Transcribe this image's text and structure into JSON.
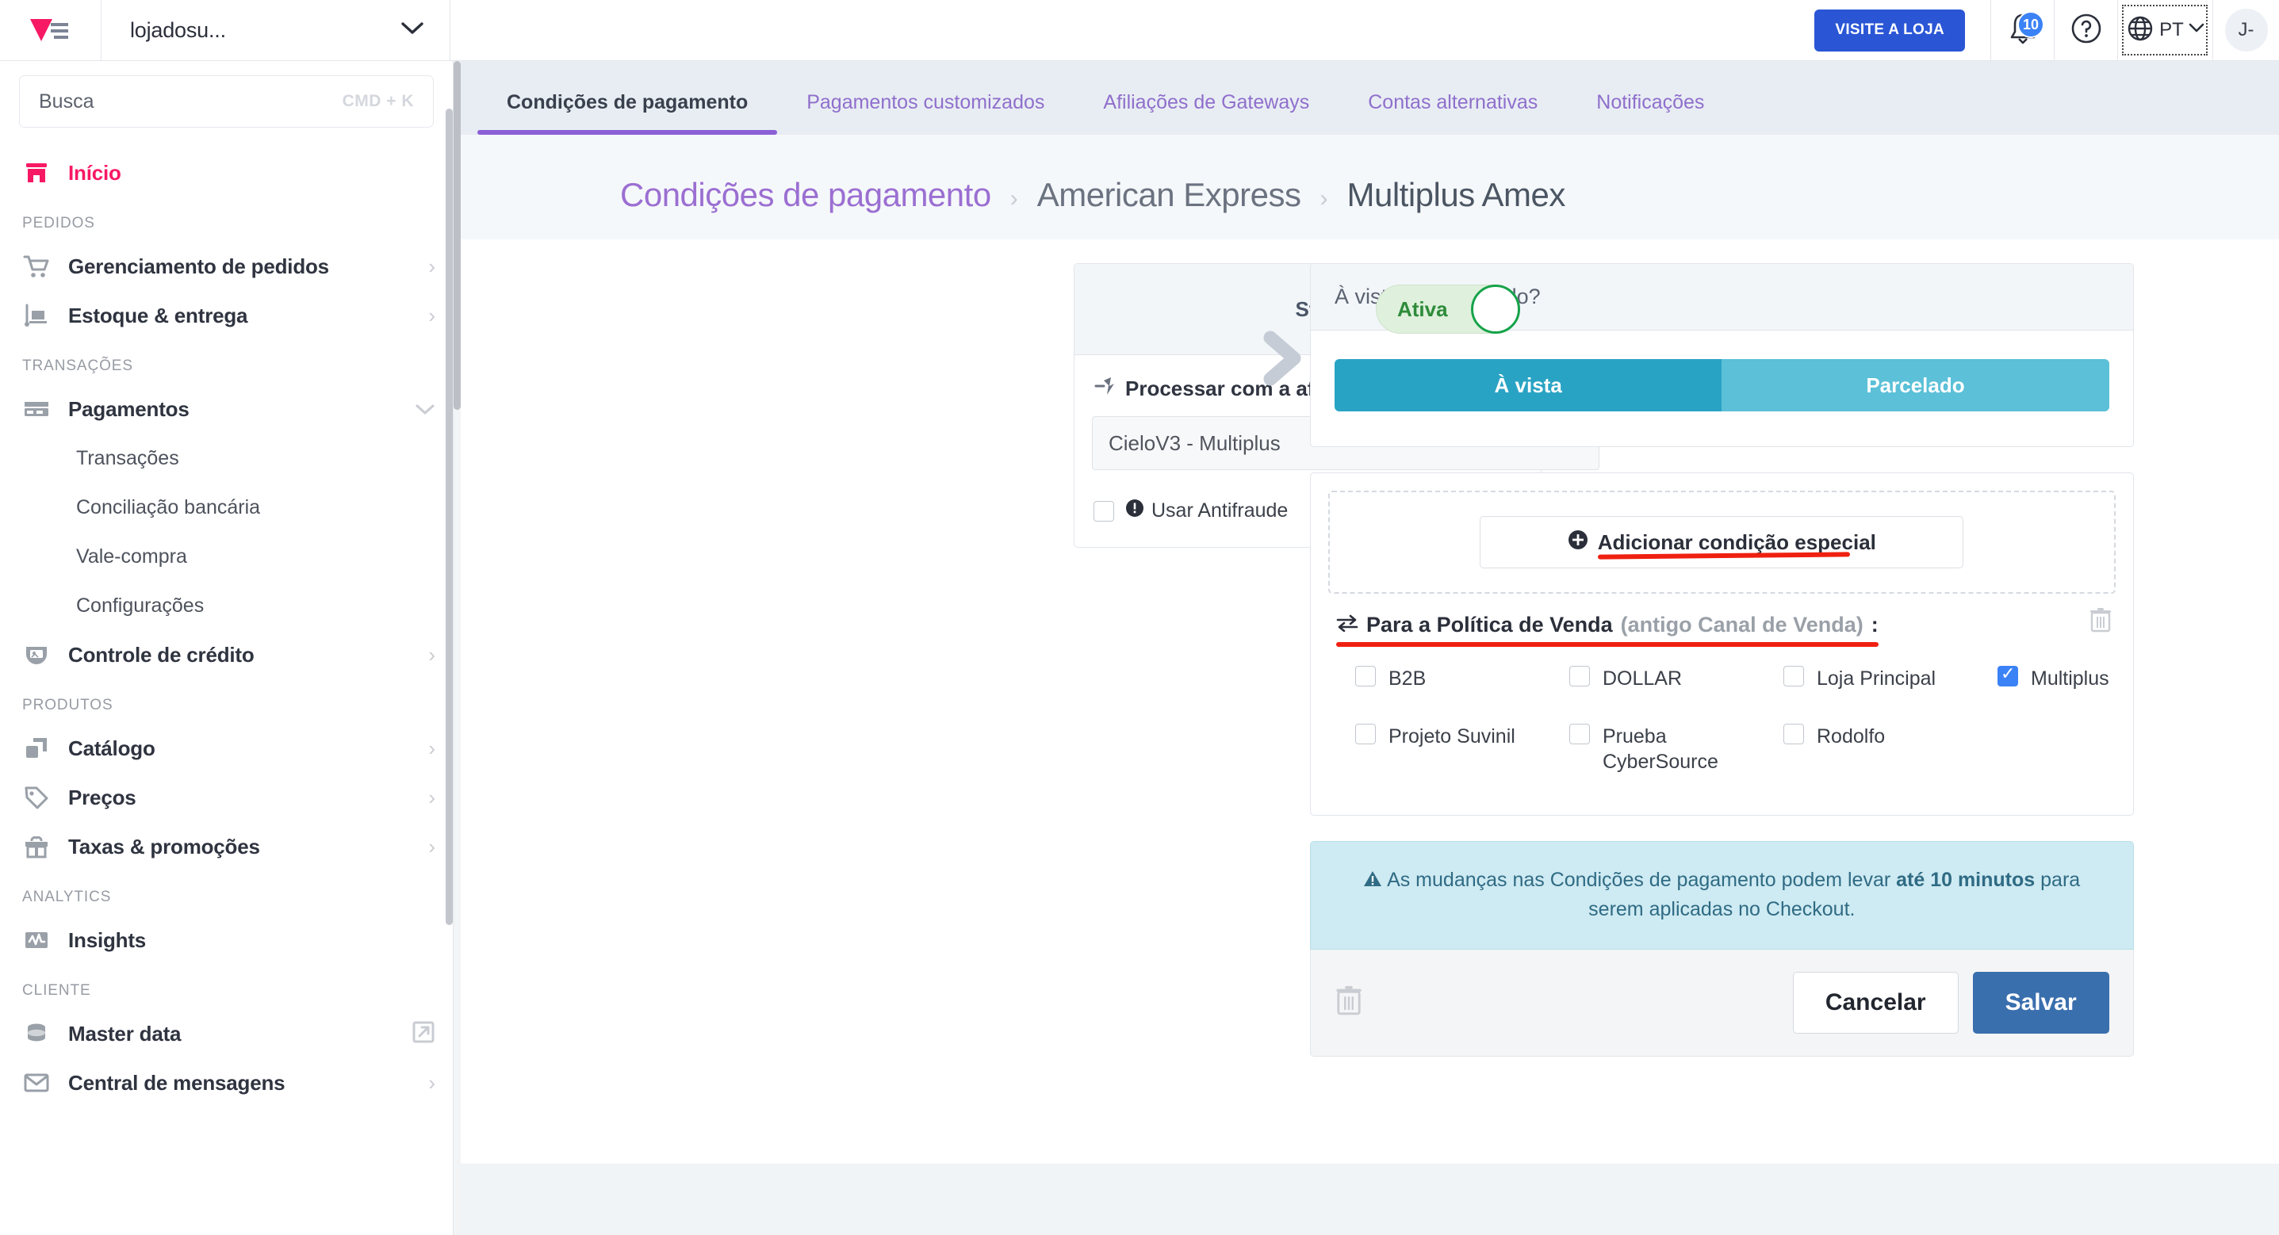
{
  "topbar": {
    "logo_icon": "vtex-logo-icon",
    "store_name": "lojadosu...",
    "store_chevron_icon": "chevron-down-icon",
    "visit_store_label": "VISITE A LOJA",
    "bell_icon": "bell-icon",
    "bell_count": "10",
    "help_icon": "question-circle-icon",
    "globe_icon": "globe-icon",
    "language": "PT",
    "language_chevron_icon": "chevron-down-icon",
    "avatar_initials": "J-"
  },
  "sidebar": {
    "search": {
      "placeholder": "Busca",
      "shortcut": "CMD + K"
    },
    "home": {
      "label": "Início",
      "icon": "home-icon"
    },
    "groups": [
      {
        "label": "PEDIDOS",
        "items": [
          {
            "label": "Gerenciamento de pedidos",
            "icon": "cart-icon",
            "chevron": "›"
          },
          {
            "label": "Estoque & entrega",
            "icon": "delivery-icon",
            "chevron": "›"
          }
        ]
      },
      {
        "label": "TRANSAÇÕES",
        "items": [
          {
            "label": "Pagamentos",
            "icon": "credit-card-icon",
            "chevron": "⌄"
          },
          {
            "label": "Controle de crédito",
            "icon": "credit-shield-icon",
            "chevron": "›"
          }
        ],
        "subitems": [
          "Transações",
          "Conciliação bancária",
          "Vale-compra",
          "Configurações"
        ]
      },
      {
        "label": "PRODUTOS",
        "items": [
          {
            "label": "Catálogo",
            "icon": "catalog-icon",
            "chevron": "›"
          },
          {
            "label": "Preços",
            "icon": "price-tag-icon",
            "chevron": "›"
          },
          {
            "label": "Taxas & promoções",
            "icon": "gift-icon",
            "chevron": "›"
          }
        ]
      },
      {
        "label": "ANALYTICS",
        "items": [
          {
            "label": "Insights",
            "icon": "pulse-icon",
            "chevron": ""
          }
        ]
      },
      {
        "label": "CLIENTE",
        "items": [
          {
            "label": "Master data",
            "icon": "database-icon",
            "chevron": "external-link-icon"
          },
          {
            "label": "Central de mensagens",
            "icon": "envelope-icon",
            "chevron": "›"
          }
        ]
      }
    ]
  },
  "tabs": [
    {
      "label": "Condições de pagamento",
      "active": true
    },
    {
      "label": "Pagamentos customizados",
      "active": false
    },
    {
      "label": "Afiliações de Gateways",
      "active": false
    },
    {
      "label": "Contas alternativas",
      "active": false
    },
    {
      "label": "Notificações",
      "active": false
    }
  ],
  "breadcrumb": {
    "root": "Condições de pagamento",
    "separator": "›",
    "mid": "American Express",
    "current": "Multiplus Amex"
  },
  "status_card": {
    "status_label": "Status",
    "toggle_value": "Ativa",
    "affiliation_label": "Processar com a afiliação:",
    "affiliation_icon": "plug-icon",
    "affiliation_value": "CieloV3 - Multiplus",
    "antifraud_label": "Usar Antifraude",
    "antifraud_info_icon": "info-icon",
    "antifraud_checked": false
  },
  "arrow_icon": "chevron-right-icon",
  "payment_mode": {
    "header": "À vista ou parcelado?",
    "options": [
      {
        "label": "À vista",
        "selected": true
      },
      {
        "label": "Parcelado",
        "selected": false
      }
    ]
  },
  "special_condition": {
    "add_button_label": "Adicionar condição especial",
    "add_button_icon": "plus-circle-icon"
  },
  "policy": {
    "icon": "transfer-icon",
    "title": "Para a Política de Venda",
    "subtitle": "(antigo Canal de Venda)",
    "colon": ":",
    "delete_icon": "trash-icon",
    "options": [
      {
        "label": "B2B",
        "checked": false
      },
      {
        "label": "DOLLAR",
        "checked": false
      },
      {
        "label": "Loja Principal",
        "checked": false
      },
      {
        "label": "Multiplus",
        "checked": true
      },
      {
        "label": "Projeto Suvinil",
        "checked": false
      },
      {
        "label": "Prueba CyberSource",
        "checked": false
      },
      {
        "label": "Rodolfo",
        "checked": false
      }
    ]
  },
  "alert": {
    "icon": "warning-icon",
    "text_before": "As mudanças nas Condições de pagamento podem levar ",
    "bold": "até 10 minutos",
    "text_after": " para serem aplicadas no Checkout."
  },
  "footer": {
    "delete_icon": "trash-icon",
    "cancel_label": "Cancelar",
    "save_label": "Salvar"
  },
  "colors": {
    "brand_pink": "#f71963",
    "accent_blue": "#2a56d6",
    "save_blue": "#3a6fae",
    "tab_purple": "#8b5fd6",
    "toggle_green": "#16a34a",
    "segment_on": "#29a3c4",
    "segment_off": "#5bc0d8",
    "alert_bg": "#ceeaf2",
    "highlight_red": "#ef2010"
  }
}
